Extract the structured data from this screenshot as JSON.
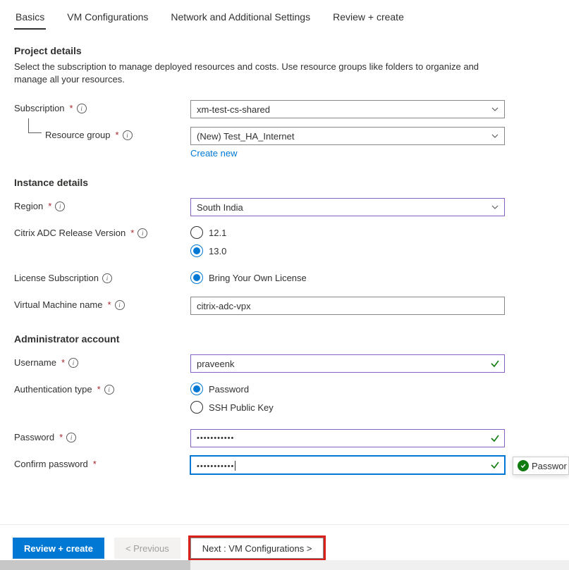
{
  "tabs": {
    "basics": "Basics",
    "vm_config": "VM Configurations",
    "network": "Network and Additional Settings",
    "review": "Review + create"
  },
  "project": {
    "heading": "Project details",
    "desc": "Select the subscription to manage deployed resources and costs. Use resource groups like folders to organize and manage all your resources.",
    "subscription_label": "Subscription",
    "subscription_value": "xm-test-cs-shared",
    "rg_label": "Resource group",
    "rg_value": "(New) Test_HA_Internet",
    "create_new": "Create new"
  },
  "instance": {
    "heading": "Instance details",
    "region_label": "Region",
    "region_value": "South India",
    "release_label": "Citrix ADC Release Version",
    "release_opt1": "12.1",
    "release_opt2": "13.0",
    "license_label": "License Subscription",
    "license_opt": "Bring Your Own License",
    "vm_label": "Virtual Machine name",
    "vm_value": "citrix-adc-vpx"
  },
  "admin": {
    "heading": "Administrator account",
    "username_label": "Username",
    "username_value": "praveenk",
    "auth_label": "Authentication type",
    "auth_opt1": "Password",
    "auth_opt2": "SSH Public Key",
    "password_label": "Password",
    "password_value": "•••••••••••",
    "confirm_label": "Confirm password",
    "confirm_value": "•••••••••••",
    "tooltip": "Passwor"
  },
  "footer": {
    "review": "Review + create",
    "previous": "< Previous",
    "next": "Next : VM Configurations >"
  }
}
